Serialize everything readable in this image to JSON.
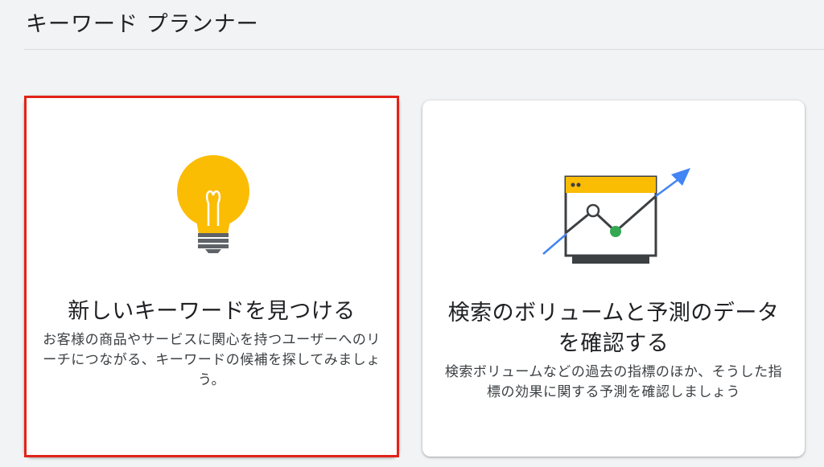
{
  "page": {
    "title": "キーワード プランナー"
  },
  "cards": [
    {
      "icon": "lightbulb-icon",
      "heading": "新しいキーワードを見つける",
      "description": "お客様の商品やサービスに関心を持つユーザーへのリーチにつながる、キーワードの候補を探してみましょう。",
      "highlighted": true
    },
    {
      "icon": "forecast-chart-icon",
      "heading": "検索のボリュームと予測のデータを確認する",
      "description": "検索ボリュームなどの過去の指標のほか、そうした指標の効果に関する予測を確認しましょう",
      "highlighted": false
    }
  ],
  "colors": {
    "background": "#f1f3f4",
    "card": "#ffffff",
    "bulb_yellow": "#fbbc04",
    "arrow_blue": "#4285f4",
    "point_green": "#34a853",
    "highlight_red": "#e2231a"
  }
}
